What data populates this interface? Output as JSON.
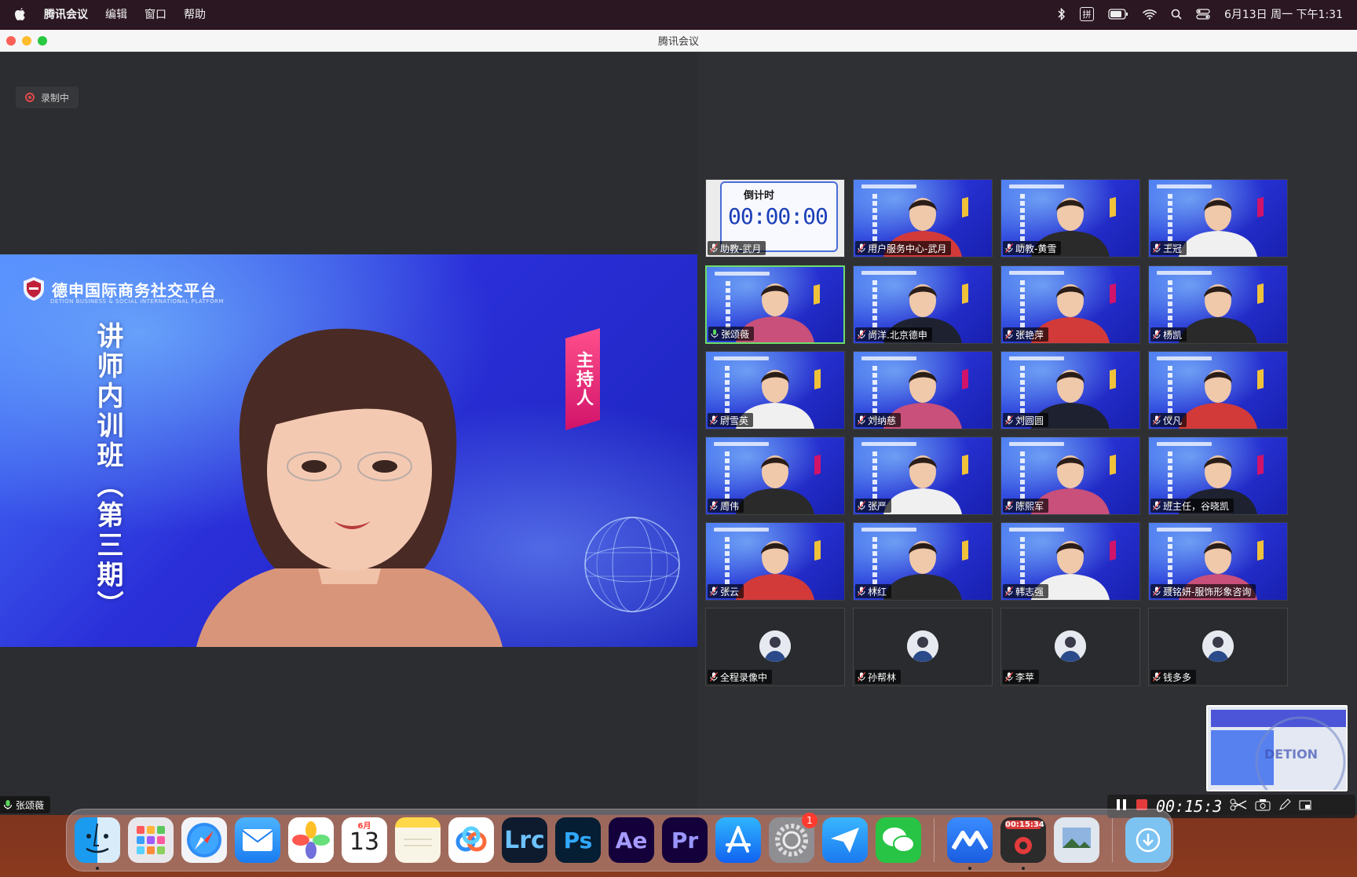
{
  "menubar": {
    "app_name": "腾讯会议",
    "menus": [
      "编辑",
      "窗口",
      "帮助"
    ],
    "ime_label": "拼",
    "datetime": "6月13日 周一 下午1:31"
  },
  "window": {
    "title": "腾讯会议"
  },
  "recording_badge": "录制中",
  "main_video": {
    "brand_title": "德申国际商务社交平台",
    "brand_subtitle": "DETION BUSINESS & SOCIAL INTERNATIONAL PLATFORM",
    "vertical_title": "讲师内训班（第三期）",
    "host_ribbon": "主持人",
    "speaker_name": "张颂薇"
  },
  "timer_tile": {
    "head": "倒计时",
    "digits": "00:00:00"
  },
  "participants": [
    {
      "name": "助教-武月",
      "type": "timer"
    },
    {
      "name": "用户服务中心-武月",
      "type": "video"
    },
    {
      "name": "助教-黄雪",
      "type": "video"
    },
    {
      "name": "王冠",
      "type": "video"
    },
    {
      "name": "张颂薇",
      "type": "video",
      "active": true
    },
    {
      "name": "尚洋.北京德申",
      "type": "video"
    },
    {
      "name": "张艳萍",
      "type": "video"
    },
    {
      "name": "杨凯",
      "type": "video"
    },
    {
      "name": "尉雪英",
      "type": "video"
    },
    {
      "name": "刘纳慈",
      "type": "video"
    },
    {
      "name": "刘圆圆",
      "type": "video"
    },
    {
      "name": "仪凡",
      "type": "video"
    },
    {
      "name": "周伟",
      "type": "video"
    },
    {
      "name": "张严",
      "type": "video"
    },
    {
      "name": "陈熙军",
      "type": "video"
    },
    {
      "name": "班主任，谷晓凯",
      "type": "video"
    },
    {
      "name": "张云",
      "type": "video"
    },
    {
      "name": "林红",
      "type": "video"
    },
    {
      "name": "韩志强",
      "type": "video"
    },
    {
      "name": "聂铭妍-服饰形象咨询",
      "type": "video"
    },
    {
      "name": "全程录像中",
      "type": "avatar"
    },
    {
      "name": "孙帮林",
      "type": "avatar"
    },
    {
      "name": "李苹",
      "type": "avatar"
    },
    {
      "name": "钱多多",
      "type": "avatar"
    }
  ],
  "recorder": {
    "elapsed": "00:15:3",
    "watermark": "DETION"
  },
  "dock": {
    "calendar_month": "6月",
    "calendar_day": "13",
    "settings_badge": "1",
    "recorder_time": "00:15:34",
    "apps": [
      "Finder",
      "Launchpad",
      "Safari",
      "Mail",
      "Photos",
      "Calendar",
      "Notes",
      "Baidu Netdisk",
      "Lightroom Classic",
      "Photoshop",
      "After Effects",
      "Premiere Pro",
      "App Store",
      "System Preferences",
      "Feishu",
      "WeChat",
      "Tencent Meeting",
      "Screen Recorder",
      "Preview",
      "Downloads"
    ],
    "labels": {
      "lrc": "Lrc",
      "ps": "Ps",
      "ae": "Ae",
      "pr": "Pr"
    }
  },
  "colors": {
    "accent_blue": "#2630d0",
    "active_green": "#6cdc6c",
    "rec_red": "#e14a4a",
    "host_pink": "#d1136a"
  }
}
